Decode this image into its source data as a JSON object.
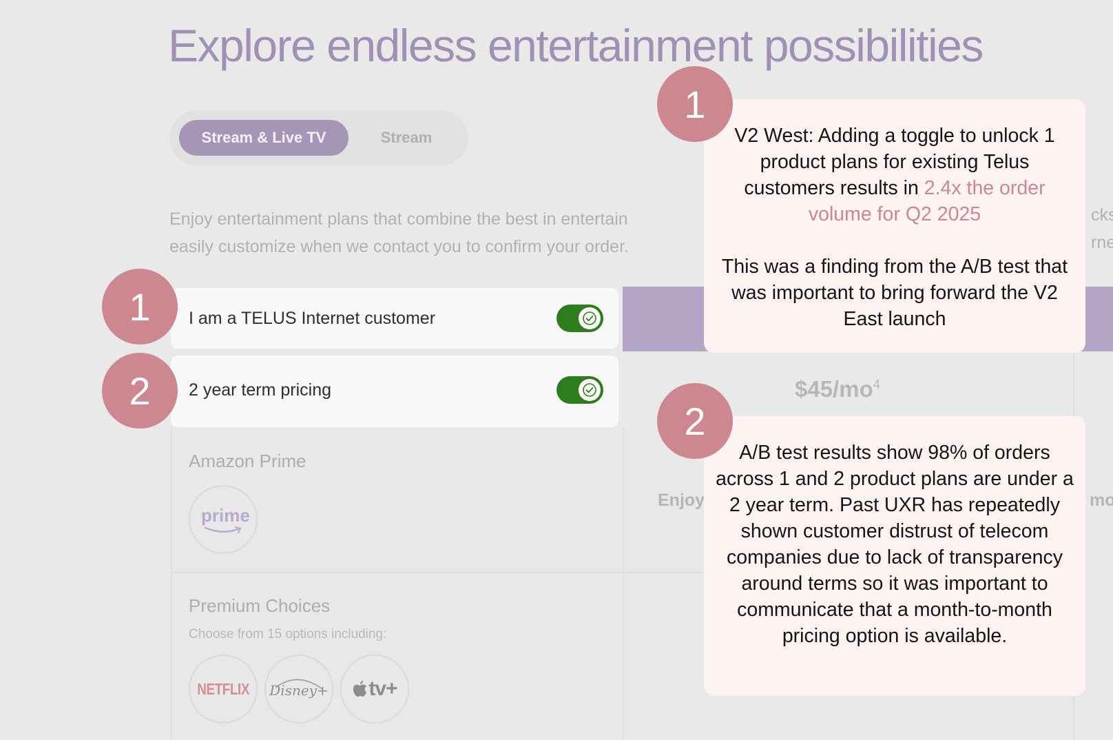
{
  "page": {
    "title": "Explore endless entertainment possibilities",
    "tabs": [
      {
        "label": "Stream & Live TV",
        "active": true
      },
      {
        "label": "Stream",
        "active": false
      }
    ],
    "intro_line1": "Enjoy entertainment plans that combine the best in entertain",
    "intro_line2": "easily customize when we contact you to confirm your order.",
    "intro_clip_right1": "cks",
    "intro_clip_right2": "rnet"
  },
  "options": [
    {
      "label": "I am a TELUS Internet customer",
      "enabled": true
    },
    {
      "label": "2 year term pricing",
      "enabled": true
    }
  ],
  "plan": {
    "price": "$45/mo",
    "price_footnote": "4",
    "enjoy_clip": "Enjoy",
    "mo_clip": "mo"
  },
  "sections": {
    "amazon": {
      "title": "Amazon Prime",
      "logo_text": "prime"
    },
    "premium": {
      "title": "Premium Choices",
      "subtitle": "Choose from 15 options including:",
      "logos": [
        {
          "icon": "netflix-logo",
          "text": "NETFLIX"
        },
        {
          "icon": "disney-plus-logo",
          "text": "Disney+"
        },
        {
          "icon": "apple-tv-plus-logo",
          "text": "tv+"
        }
      ]
    }
  },
  "annotations": {
    "badges": [
      "1",
      "2"
    ],
    "note1": {
      "text_a": "V2 West: Adding a toggle to unlock 1 product plans for existing Telus customers results in",
      "highlight": "2.4x the order volume for Q2 2025",
      "text_b": "This was a finding from the A/B test that was important to bring forward the V2 East launch"
    },
    "note2": {
      "text": "A/B test results show 98% of orders across 1 and 2 product plans are under a 2 year term. Past UXR has repeatedly shown customer distrust of telecom companies due to lack of transparency around terms so it was important to communicate that a month-to-month pricing option is available."
    }
  },
  "colors": {
    "background": "#e9e9e9",
    "brand_purple": "#a596b7",
    "toggle_on": "#2e7d1d",
    "badge": "#cc8790",
    "note_bg": "#fdf3f2",
    "highlight": "#cc8790"
  }
}
